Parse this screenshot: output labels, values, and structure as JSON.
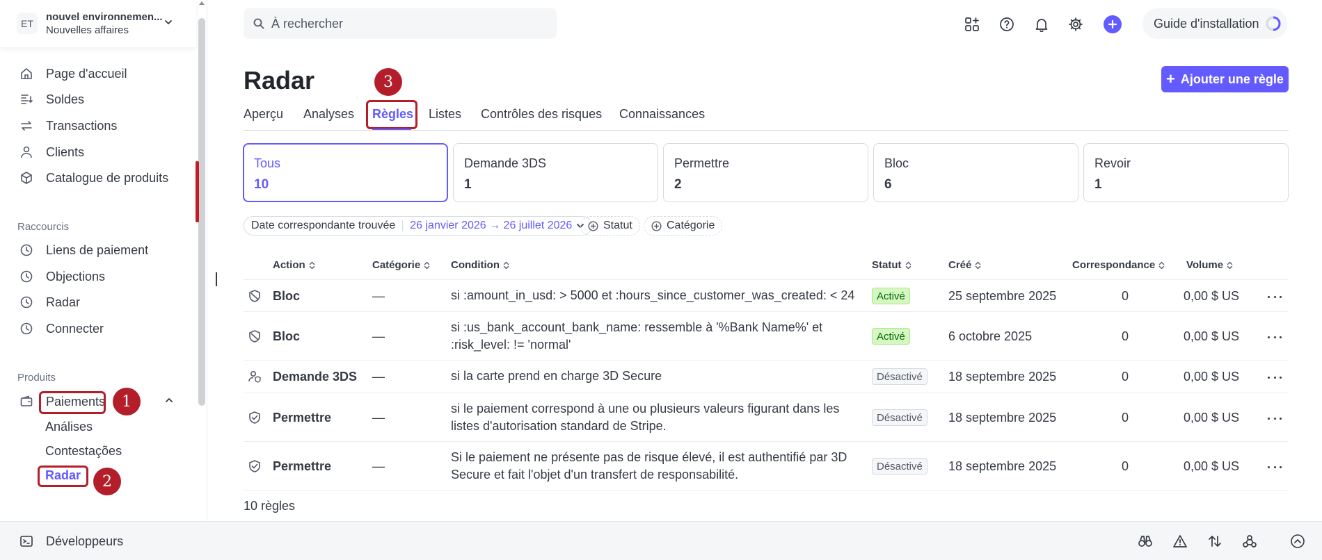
{
  "account": {
    "badge": "ET",
    "name": "nouvel environnemen...",
    "subtitle": "Nouvelles affaires"
  },
  "sidebar": {
    "main": [
      {
        "label": "Page d'accueil",
        "icon": "home-icon"
      },
      {
        "label": "Soldes",
        "icon": "balance-icon"
      },
      {
        "label": "Transactions",
        "icon": "transactions-icon"
      },
      {
        "label": "Clients",
        "icon": "user-icon"
      },
      {
        "label": "Catalogue de produits",
        "icon": "box-icon"
      }
    ],
    "shortcuts_label": "Raccourcis",
    "shortcuts": [
      {
        "label": "Liens de paiement",
        "icon": "clock-icon"
      },
      {
        "label": "Objections",
        "icon": "clock-icon"
      },
      {
        "label": "Radar",
        "icon": "clock-icon"
      },
      {
        "label": "Connecter",
        "icon": "clock-icon"
      }
    ],
    "products_label": "Produits",
    "payments": {
      "label": "Paiements",
      "icon": "wallet-icon"
    },
    "payments_sub": [
      "Análises",
      "Contestações",
      "Radar"
    ]
  },
  "developers": {
    "label": "Développeurs"
  },
  "topbar": {
    "search_placeholder": "À rechercher",
    "guide_label": "Guide d'installation"
  },
  "annotations": [
    "1",
    "2",
    "3"
  ],
  "page": {
    "title": "Radar",
    "add_rule": "Ajouter une règle"
  },
  "tabs": [
    "Aperçu",
    "Analyses",
    "Règles",
    "Listes",
    "Contrôles des risques",
    "Connaissances"
  ],
  "cards": [
    {
      "label": "Tous",
      "count": "10"
    },
    {
      "label": "Demande 3DS",
      "count": "1"
    },
    {
      "label": "Permettre",
      "count": "2"
    },
    {
      "label": "Bloc",
      "count": "6"
    },
    {
      "label": "Revoir",
      "count": "1"
    }
  ],
  "filters": {
    "date_label": "Date correspondante trouvée",
    "date_value": "26 janvier 2026 → 26 juillet 2026",
    "status": "Statut",
    "category": "Catégorie"
  },
  "table": {
    "headers": [
      "Action",
      "Catégorie",
      "Condition",
      "Statut",
      "Créé",
      "Correspondance",
      "Volume"
    ],
    "rows": [
      {
        "icon": "block-icon",
        "action": "Bloc",
        "category": "—",
        "condition": [
          "si :amount_in_usd: > 5000 et :hours_since_customer_was_created: < 24"
        ],
        "status": "Activé",
        "status_type": "on",
        "created": "25 septembre 2025",
        "matches": "0",
        "volume": "0,00 $ US"
      },
      {
        "icon": "block-icon",
        "action": "Bloc",
        "category": "—",
        "condition": [
          "si :us_bank_account_bank_name: ressemble à '%Bank Name%' et",
          ":risk_level: != 'normal'"
        ],
        "status": "Activé",
        "status_type": "on",
        "created": "6 octobre 2025",
        "matches": "0",
        "volume": "0,00 $ US"
      },
      {
        "icon": "user-shield-icon",
        "action": "Demande 3DS",
        "category": "—",
        "condition": [
          "si la carte prend en charge 3D Secure"
        ],
        "status": "Désactivé",
        "status_type": "off",
        "created": "18 septembre 2025",
        "matches": "0",
        "volume": "0,00 $ US"
      },
      {
        "icon": "shield-check-icon",
        "action": "Permettre",
        "category": "—",
        "condition": [
          "si le paiement correspond à une ou plusieurs valeurs figurant dans les",
          "listes d'autorisation standard de Stripe."
        ],
        "status": "Désactivé",
        "status_type": "off",
        "created": "18 septembre 2025",
        "matches": "0",
        "volume": "0,00 $ US"
      },
      {
        "icon": "shield-check-icon",
        "action": "Permettre",
        "category": "—",
        "condition": [
          "Si le paiement ne présente pas de risque élevé, il est authentifié par 3D",
          "Secure et fait l'objet d'un transfert de responsabilité."
        ],
        "status": "Désactivé",
        "status_type": "off",
        "created": "18 septembre 2025",
        "matches": "0",
        "volume": "0,00 $ US"
      }
    ],
    "footer": "10 règles"
  },
  "colors": {
    "accent": "#635bff",
    "annotation_red": "#b31e2a",
    "active_bg": "#d7f7c2",
    "active_text": "#05690d"
  }
}
